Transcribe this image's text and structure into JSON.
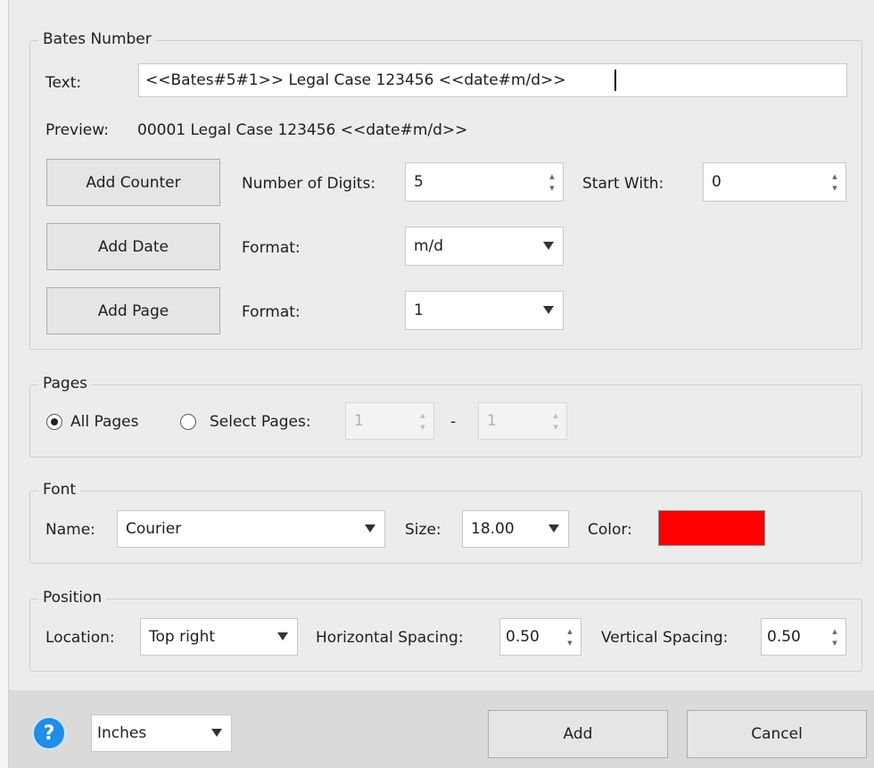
{
  "bates": {
    "legend": "Bates Number",
    "text_label": "Text:",
    "text_value": "<<Bates#5#1>> Legal Case 123456 <<date#m/d>>",
    "preview_label": "Preview:",
    "preview_value": "00001 Legal Case 123456 <<date#m/d>>",
    "add_counter": "Add Counter",
    "digits_label": "Number of Digits:",
    "digits_value": "5",
    "start_label": "Start With:",
    "start_value": "0",
    "add_date": "Add Date",
    "date_format_label": "Format:",
    "date_format_value": "m/d",
    "add_page": "Add Page",
    "page_format_label": "Format:",
    "page_format_value": "1"
  },
  "pages": {
    "legend": "Pages",
    "all_pages": "All Pages",
    "all_pages_selected": true,
    "select_pages": "Select Pages:",
    "from_value": "1",
    "dash": "-",
    "to_value": "1"
  },
  "font": {
    "legend": "Font",
    "name_label": "Name:",
    "name_value": "Courier",
    "size_label": "Size:",
    "size_value": "18.00",
    "color_label": "Color:",
    "color_value": "#ff0000"
  },
  "position": {
    "legend": "Position",
    "location_label": "Location:",
    "location_value": "Top right",
    "hspacing_label": "Horizontal Spacing:",
    "hspacing_value": "0.50",
    "vspacing_label": "Vertical Spacing:",
    "vspacing_value": "0.50"
  },
  "footer": {
    "help_icon": "?",
    "units_value": "Inches",
    "add_button": "Add",
    "cancel_button": "Cancel"
  },
  "icons": {
    "spin": "spin-up-down-icon",
    "dropdown": "chevron-down-icon",
    "help": "help-icon"
  }
}
